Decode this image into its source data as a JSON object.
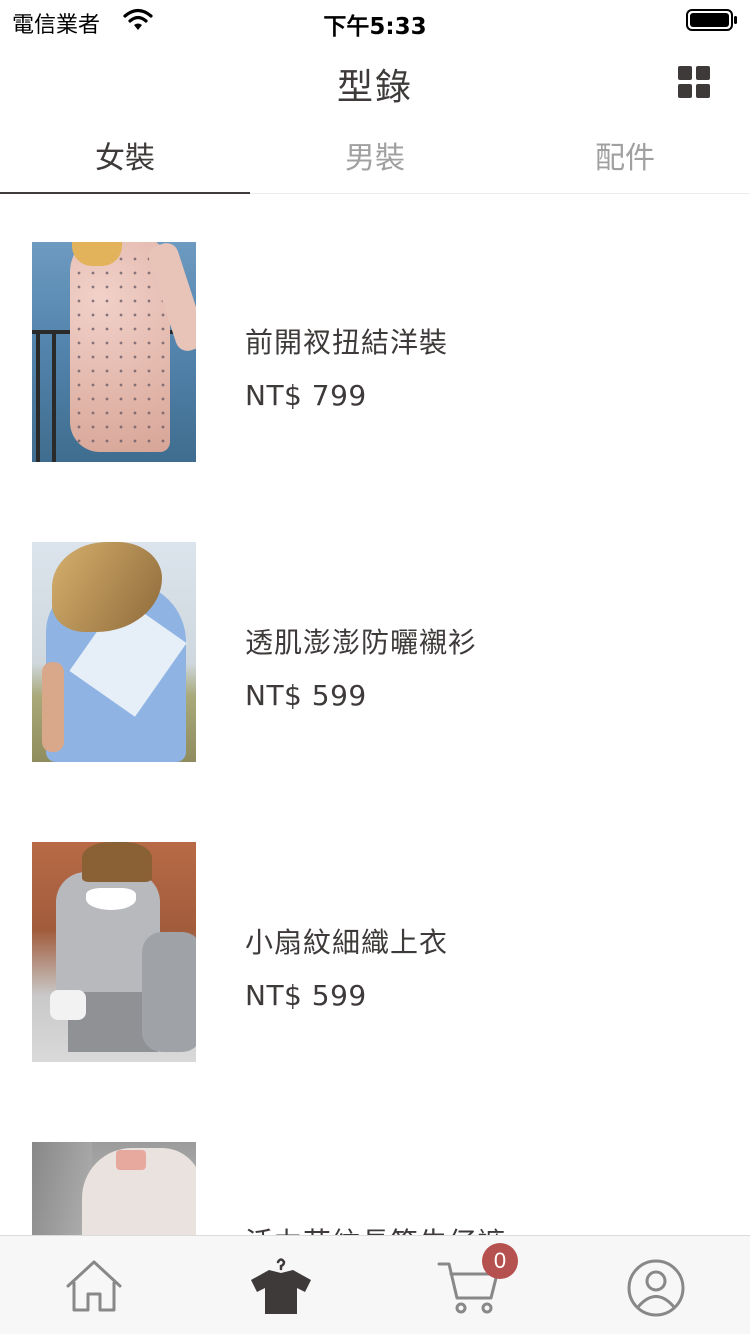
{
  "status_bar": {
    "carrier": "電信業者",
    "time": "下午5:33"
  },
  "header": {
    "title": "型錄"
  },
  "tabs": [
    {
      "label": "女裝",
      "active": true
    },
    {
      "label": "男裝",
      "active": false
    },
    {
      "label": "配件",
      "active": false
    }
  ],
  "products": [
    {
      "name": "前開衩扭結洋裝",
      "price": "NT$ 799"
    },
    {
      "name": "透肌澎澎防曬襯衫",
      "price": "NT$ 599"
    },
    {
      "name": "小扇紋細織上衣",
      "price": "NT$ 599"
    },
    {
      "name": "活力花紋長筒牛仔褲",
      "price": ""
    }
  ],
  "tab_bar": {
    "items": [
      {
        "icon": "home-icon"
      },
      {
        "icon": "shirt-icon",
        "active": true
      },
      {
        "icon": "cart-icon"
      },
      {
        "icon": "profile-icon"
      }
    ],
    "cart_badge": "0"
  },
  "colors": {
    "text_primary": "#3f3a3a",
    "tab_inactive": "#a0a0a0",
    "badge": "#b5514f",
    "tab_bar_bg": "#f7f7f7"
  }
}
